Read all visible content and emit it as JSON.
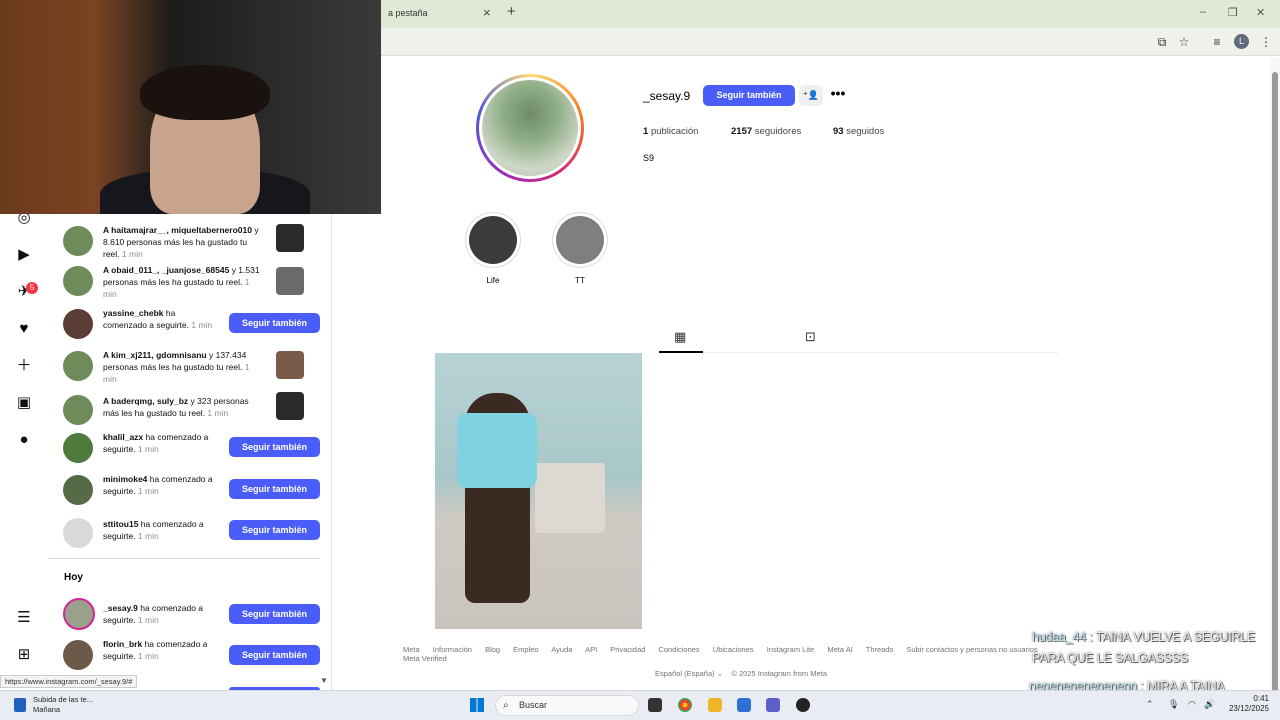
{
  "browser": {
    "tab_label": "a pestaña",
    "tab_close": "×",
    "tab_new": "+",
    "win_min": "–",
    "win_max": "❐",
    "win_close": "✕",
    "profile_initial": "L"
  },
  "nav": {
    "badge_count": "5"
  },
  "notifications": {
    "items": [
      {
        "user": "A haitamajrar__, miqueltabernero010",
        "rest": " y 8.610 personas más les ha gustado tu reel.",
        "time": " 1 min"
      },
      {
        "user": "A obaid_011_, _juanjose_68545",
        "rest": " y 1.531 personas más les ha gustado tu reel.",
        "time": " 1 min"
      },
      {
        "user": "yassine_chebk",
        "rest": " ha comenzado a seguirte.",
        "time": " 1 min"
      },
      {
        "user": "A kim_xj211, gdomnisanu",
        "rest": " y 137.434 personas más les ha gustado tu reel.",
        "time": " 1 min"
      },
      {
        "user": "A baderqmg, suly_bz",
        "rest": " y 323 personas más les ha gustado tu reel.",
        "time": " 1 min"
      },
      {
        "user": "khalil_azx",
        "rest": " ha comenzado a seguirte.",
        "time": " 1 min"
      },
      {
        "user": "minimoke4",
        "rest": " ha comenzado a seguirte.",
        "time": " 1 min"
      },
      {
        "user": "sttitou15",
        "rest": " ha comenzado a seguirte.",
        "time": " 1 min"
      },
      {
        "user": "_sesay.9",
        "rest": " ha comenzado a seguirte.",
        "time": " 1 min"
      },
      {
        "user": "florin_brk",
        "rest": " ha comenzado a seguirte.",
        "time": " 1 min"
      }
    ],
    "follow_label": "Seguir también",
    "section_today": "Hoy",
    "partial_row": "ha"
  },
  "profile": {
    "username": "_sesay.9",
    "follow_label": "Seguir también",
    "more": "•••",
    "posts_count": "1",
    "posts_label": "publicación",
    "followers_count": "2157",
    "followers_label": "seguidores",
    "following_count": "93",
    "following_label": "seguidos",
    "bio": "S9",
    "highlights": [
      {
        "label": "Life"
      },
      {
        "label": "TT"
      }
    ]
  },
  "footer": {
    "links": [
      "Meta",
      "Información",
      "Blog",
      "Empleo",
      "Ayuda",
      "API",
      "Privacidad",
      "Condiciones",
      "Ubicaciones",
      "Instagram Lite",
      "Meta AI",
      "Threads",
      "Subir contactos y personas no usuarios",
      "Meta Verified"
    ],
    "language": "Español (España)",
    "copyright": "© 2025 Instagram from Meta"
  },
  "chat": {
    "msg1_user": "hudaa_44",
    "msg1_text": " : TAINA VUELVE A SEGUIRLE PARA QUE LE SALGASSSS",
    "msg2_user": "nenenenenenenenn",
    "msg2_text": " : MIRA A TAINA LEFRAAA"
  },
  "status_url": "https://www.instagram.com/_sesay.9/#",
  "taskbar": {
    "weather_line1": "Subida de las te...",
    "weather_line2": "Mañana",
    "search_placeholder": "Buscar",
    "time": "0:41",
    "date": "23/12/2025"
  },
  "colors": {
    "accent": "#4a5df9",
    "badge": "#ff3040"
  }
}
